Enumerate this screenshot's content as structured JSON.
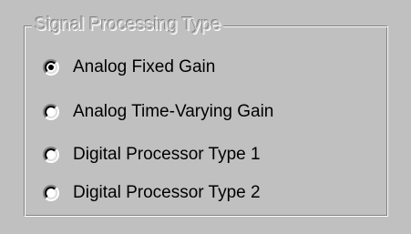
{
  "group": {
    "title": "Signal Processing Type"
  },
  "options": [
    {
      "label": "Analog Fixed Gain",
      "selected": true
    },
    {
      "label": "Analog Time-Varying Gain",
      "selected": false
    },
    {
      "label": "Digital Processor Type 1",
      "selected": false
    },
    {
      "label": "Digital Processor Type 2",
      "selected": false
    }
  ],
  "colors": {
    "face": "#c0c0c0",
    "shadow": "#808080",
    "highlight": "#ffffff",
    "text": "#000000"
  }
}
